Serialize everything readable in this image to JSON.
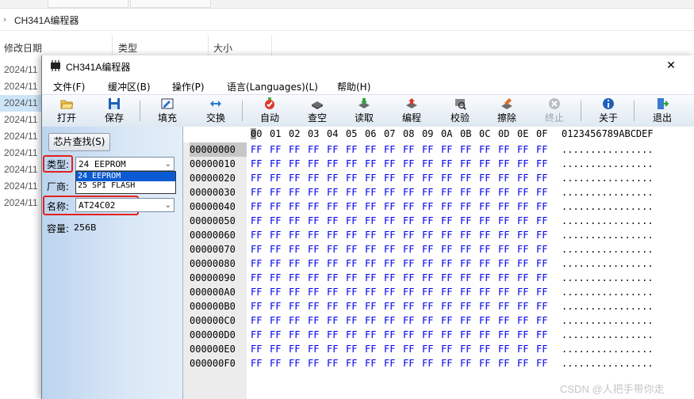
{
  "explorer": {
    "breadcrumb": "CH341A编程器",
    "columns": [
      "修改日期",
      "类型",
      "大小"
    ],
    "dates": [
      "2024/11",
      "2024/11",
      "2024/11",
      "2024/11",
      "2024/11",
      "2024/11",
      "2024/11",
      "2024/11",
      "2024/11"
    ]
  },
  "window": {
    "title": "CH341A编程器",
    "close_glyph": "✕"
  },
  "menu": [
    "文件(F)",
    "缓冲区(B)",
    "操作(P)",
    "语言(Languages)(L)",
    "帮助(H)"
  ],
  "toolbar": [
    {
      "label": "打开",
      "icon": "folder-open-icon"
    },
    {
      "label": "保存",
      "icon": "save-icon"
    },
    {
      "label": "填充",
      "icon": "fill-icon"
    },
    {
      "label": "交换",
      "icon": "swap-icon"
    },
    {
      "label": "自动",
      "icon": "auto-icon"
    },
    {
      "label": "查空",
      "icon": "blank-check-icon"
    },
    {
      "label": "读取",
      "icon": "read-icon"
    },
    {
      "label": "编程",
      "icon": "program-icon"
    },
    {
      "label": "校验",
      "icon": "verify-icon"
    },
    {
      "label": "擦除",
      "icon": "erase-icon"
    },
    {
      "label": "终止",
      "icon": "stop-icon"
    },
    {
      "label": "关于",
      "icon": "info-icon"
    },
    {
      "label": "退出",
      "icon": "exit-icon"
    }
  ],
  "panel": {
    "find_button": "芯片查找(S)",
    "type_label": "类型:",
    "type_value": "24 EEPROM",
    "type_options": [
      "24 EEPROM",
      "25 SPI FLASH"
    ],
    "vendor_label": "厂商:",
    "name_label": "名称:",
    "name_value": "AT24C02",
    "capacity_label": "容量:",
    "capacity_value": "256B"
  },
  "hex": {
    "header_cols": [
      "00",
      "01",
      "02",
      "03",
      "04",
      "05",
      "06",
      "07",
      "08",
      "09",
      "0A",
      "0B",
      "0C",
      "0D",
      "0E",
      "0F"
    ],
    "ascii_header": "0123456789ABCDEF",
    "rows": [
      {
        "addr": "00000000",
        "bytes": [
          "FF",
          "FF",
          "FF",
          "FF",
          "FF",
          "FF",
          "FF",
          "FF",
          "FF",
          "FF",
          "FF",
          "FF",
          "FF",
          "FF",
          "FF",
          "FF"
        ],
        "ascii": "................"
      },
      {
        "addr": "00000010",
        "bytes": [
          "FF",
          "FF",
          "FF",
          "FF",
          "FF",
          "FF",
          "FF",
          "FF",
          "FF",
          "FF",
          "FF",
          "FF",
          "FF",
          "FF",
          "FF",
          "FF"
        ],
        "ascii": "................"
      },
      {
        "addr": "00000020",
        "bytes": [
          "FF",
          "FF",
          "FF",
          "FF",
          "FF",
          "FF",
          "FF",
          "FF",
          "FF",
          "FF",
          "FF",
          "FF",
          "FF",
          "FF",
          "FF",
          "FF"
        ],
        "ascii": "................"
      },
      {
        "addr": "00000030",
        "bytes": [
          "FF",
          "FF",
          "FF",
          "FF",
          "FF",
          "FF",
          "FF",
          "FF",
          "FF",
          "FF",
          "FF",
          "FF",
          "FF",
          "FF",
          "FF",
          "FF"
        ],
        "ascii": "................"
      },
      {
        "addr": "00000040",
        "bytes": [
          "FF",
          "FF",
          "FF",
          "FF",
          "FF",
          "FF",
          "FF",
          "FF",
          "FF",
          "FF",
          "FF",
          "FF",
          "FF",
          "FF",
          "FF",
          "FF"
        ],
        "ascii": "................"
      },
      {
        "addr": "00000050",
        "bytes": [
          "FF",
          "FF",
          "FF",
          "FF",
          "FF",
          "FF",
          "FF",
          "FF",
          "FF",
          "FF",
          "FF",
          "FF",
          "FF",
          "FF",
          "FF",
          "FF"
        ],
        "ascii": "................"
      },
      {
        "addr": "00000060",
        "bytes": [
          "FF",
          "FF",
          "FF",
          "FF",
          "FF",
          "FF",
          "FF",
          "FF",
          "FF",
          "FF",
          "FF",
          "FF",
          "FF",
          "FF",
          "FF",
          "FF"
        ],
        "ascii": "................"
      },
      {
        "addr": "00000070",
        "bytes": [
          "FF",
          "FF",
          "FF",
          "FF",
          "FF",
          "FF",
          "FF",
          "FF",
          "FF",
          "FF",
          "FF",
          "FF",
          "FF",
          "FF",
          "FF",
          "FF"
        ],
        "ascii": "................"
      },
      {
        "addr": "00000080",
        "bytes": [
          "FF",
          "FF",
          "FF",
          "FF",
          "FF",
          "FF",
          "FF",
          "FF",
          "FF",
          "FF",
          "FF",
          "FF",
          "FF",
          "FF",
          "FF",
          "FF"
        ],
        "ascii": "................"
      },
      {
        "addr": "00000090",
        "bytes": [
          "FF",
          "FF",
          "FF",
          "FF",
          "FF",
          "FF",
          "FF",
          "FF",
          "FF",
          "FF",
          "FF",
          "FF",
          "FF",
          "FF",
          "FF",
          "FF"
        ],
        "ascii": "................"
      },
      {
        "addr": "000000A0",
        "bytes": [
          "FF",
          "FF",
          "FF",
          "FF",
          "FF",
          "FF",
          "FF",
          "FF",
          "FF",
          "FF",
          "FF",
          "FF",
          "FF",
          "FF",
          "FF",
          "FF"
        ],
        "ascii": "................"
      },
      {
        "addr": "000000B0",
        "bytes": [
          "FF",
          "FF",
          "FF",
          "FF",
          "FF",
          "FF",
          "FF",
          "FF",
          "FF",
          "FF",
          "FF",
          "FF",
          "FF",
          "FF",
          "FF",
          "FF"
        ],
        "ascii": "................"
      },
      {
        "addr": "000000C0",
        "bytes": [
          "FF",
          "FF",
          "FF",
          "FF",
          "FF",
          "FF",
          "FF",
          "FF",
          "FF",
          "FF",
          "FF",
          "FF",
          "FF",
          "FF",
          "FF",
          "FF"
        ],
        "ascii": "................"
      },
      {
        "addr": "000000D0",
        "bytes": [
          "FF",
          "FF",
          "FF",
          "FF",
          "FF",
          "FF",
          "FF",
          "FF",
          "FF",
          "FF",
          "FF",
          "FF",
          "FF",
          "FF",
          "FF",
          "FF"
        ],
        "ascii": "................"
      },
      {
        "addr": "000000E0",
        "bytes": [
          "FF",
          "FF",
          "FF",
          "FF",
          "FF",
          "FF",
          "FF",
          "FF",
          "FF",
          "FF",
          "FF",
          "FF",
          "FF",
          "FF",
          "FF",
          "FF"
        ],
        "ascii": "................"
      },
      {
        "addr": "000000F0",
        "bytes": [
          "FF",
          "FF",
          "FF",
          "FF",
          "FF",
          "FF",
          "FF",
          "FF",
          "FF",
          "FF",
          "FF",
          "FF",
          "FF",
          "FF",
          "FF",
          "FF"
        ],
        "ascii": "................"
      }
    ]
  },
  "watermark": "CSDN @人把手带你走",
  "colors": {
    "accent_red": "#e52020",
    "hex_blue": "#0000ee",
    "selection_blue": "#0a5bd3"
  }
}
